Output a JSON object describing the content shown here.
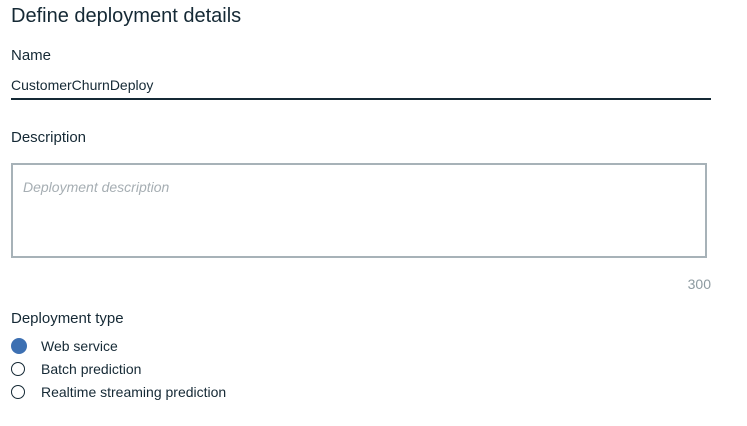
{
  "header": {
    "title": "Define deployment details"
  },
  "name_field": {
    "label": "Name",
    "value": "CustomerChurnDeploy"
  },
  "description_field": {
    "label": "Description",
    "placeholder": "Deployment description",
    "value": "",
    "char_counter": "300"
  },
  "deployment_type": {
    "label": "Deployment type",
    "selected": "Web service",
    "options": [
      {
        "label": "Web service",
        "selected": true
      },
      {
        "label": "Batch prediction",
        "selected": false
      },
      {
        "label": "Realtime streaming prediction",
        "selected": false
      }
    ]
  },
  "colors": {
    "text": "#152935",
    "accent": "#3d70b2",
    "border": "#a7b2b8",
    "placeholder": "#a6aeb3",
    "counter": "#8d9aa0"
  }
}
